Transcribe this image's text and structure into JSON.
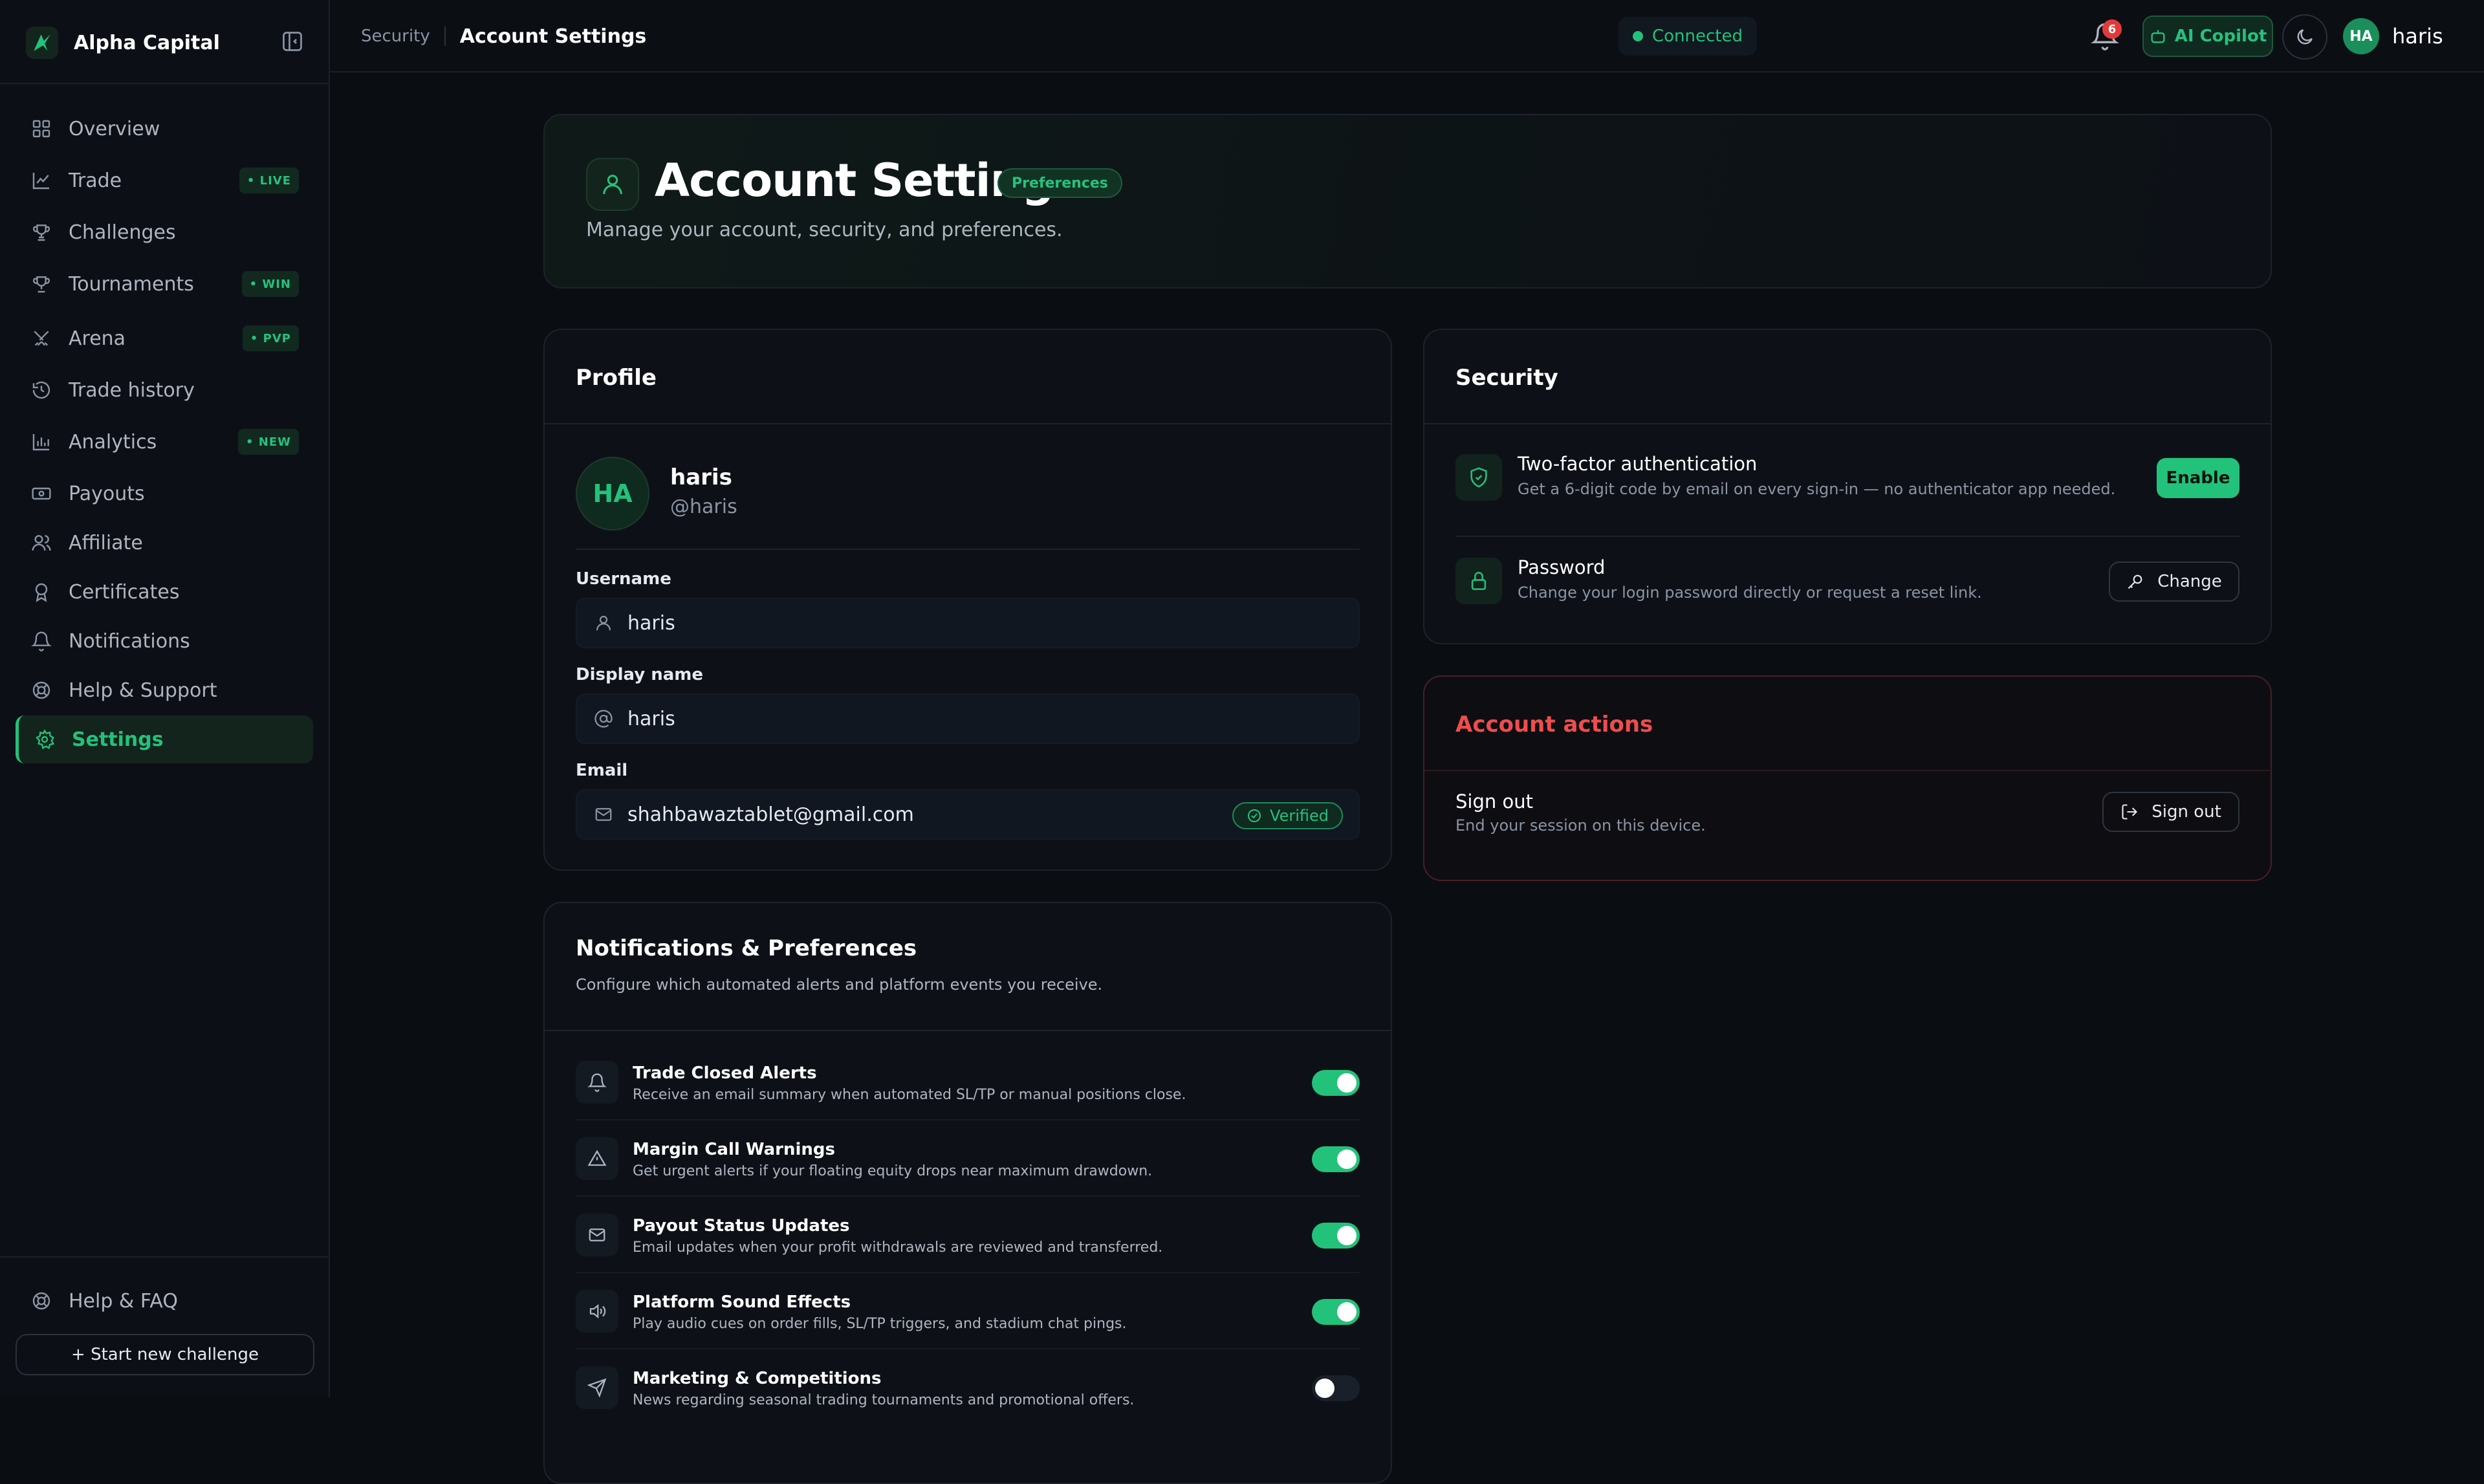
{
  "brand": {
    "name": "Alpha Capital"
  },
  "sidebar": {
    "items": [
      {
        "label": "Overview",
        "icon": "grid-icon"
      },
      {
        "label": "Trade",
        "icon": "chart-icon",
        "badge": "• LIVE"
      },
      {
        "label": "Challenges",
        "icon": "trophy-icon"
      },
      {
        "label": "Tournaments",
        "icon": "trophy-icon",
        "badge": "• WIN"
      },
      {
        "label": "Arena",
        "icon": "swords-icon",
        "badge": "• PVP"
      },
      {
        "label": "Trade history",
        "icon": "history-icon"
      },
      {
        "label": "Analytics",
        "icon": "bar-chart-icon",
        "badge": "• NEW"
      },
      {
        "label": "Payouts",
        "icon": "banknote-icon"
      },
      {
        "label": "Affiliate",
        "icon": "users-icon"
      },
      {
        "label": "Certificates",
        "icon": "award-icon"
      },
      {
        "label": "Notifications",
        "icon": "bell-icon"
      },
      {
        "label": "Help & Support",
        "icon": "lifebuoy-icon"
      },
      {
        "label": "Settings",
        "icon": "gear-icon",
        "active": true
      }
    ],
    "footer_help": "Help & FAQ",
    "start_button": "+ Start new challenge"
  },
  "topbar": {
    "breadcrumb_parent": "Security",
    "breadcrumb_current": "Account Settings",
    "status": "Connected",
    "notification_count": "6",
    "copilot_label": "AI Copilot",
    "user_initials": "HA",
    "user_name": "haris"
  },
  "hero": {
    "title": "Account Settings",
    "pill": "Preferences",
    "subtitle": "Manage your account, security, and preferences."
  },
  "profile": {
    "title": "Profile",
    "initials": "HA",
    "name": "haris",
    "handle": "@haris",
    "username_label": "Username",
    "username_value": "haris",
    "display_label": "Display name",
    "display_value": "haris",
    "email_label": "Email",
    "email_value": "shahbawaztablet@gmail.com",
    "verified_label": "Verified"
  },
  "security": {
    "title": "Security",
    "twofa_title": "Two-factor authentication",
    "twofa_desc": "Get a 6-digit code by email on every sign-in — no authenticator app needed.",
    "enable_label": "Enable",
    "password_title": "Password",
    "password_desc": "Change your login password directly or request a reset link.",
    "change_label": "Change"
  },
  "account_actions": {
    "title": "Account actions",
    "signout_title": "Sign out",
    "signout_desc": "End your session on this device.",
    "signout_button": "Sign out"
  },
  "notifications": {
    "title": "Notifications & Preferences",
    "subtitle": "Configure which automated alerts and platform events you receive.",
    "rows": [
      {
        "title": "Trade Closed Alerts",
        "desc": "Receive an email summary when automated SL/TP or manual positions close.",
        "enabled": true,
        "icon": "bell-icon"
      },
      {
        "title": "Margin Call Warnings",
        "desc": "Get urgent alerts if your floating equity drops near maximum drawdown.",
        "enabled": true,
        "icon": "warning-icon"
      },
      {
        "title": "Payout Status Updates",
        "desc": "Email updates when your profit withdrawals are reviewed and transferred.",
        "enabled": true,
        "icon": "mail-icon"
      },
      {
        "title": "Platform Sound Effects",
        "desc": "Play audio cues on order fills, SL/TP triggers, and stadium chat pings.",
        "enabled": true,
        "icon": "speaker-icon"
      },
      {
        "title": "Marketing & Competitions",
        "desc": "News regarding seasonal trading tournaments and promotional offers.",
        "enabled": false,
        "icon": "send-icon"
      }
    ]
  },
  "colors": {
    "accent": "#22c27a",
    "danger": "#ee4d4d",
    "background": "#0a0d12"
  }
}
